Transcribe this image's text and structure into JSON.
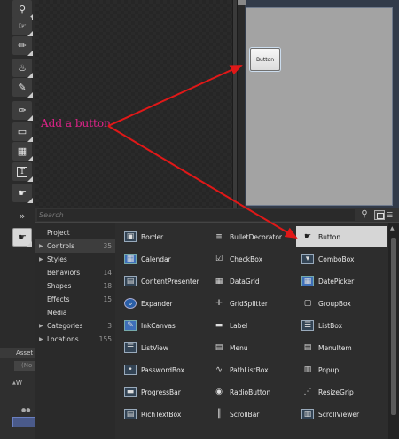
{
  "annotation": {
    "text": "Add a button"
  },
  "canvas": {
    "button_label": "Button"
  },
  "search": {
    "placeholder": "Search"
  },
  "icons": {
    "zoom": "magnifier-icon",
    "direct_select": "direct-select-icon",
    "eyedropper": "eyedropper-icon",
    "paint_bucket": "paint-bucket-icon",
    "pencil": "pencil-icon",
    "pen": "pen-icon",
    "rectangle": "rectangle-icon",
    "grid": "grid-icon",
    "text": "text-icon",
    "hand_select": "hand-select-icon"
  },
  "categories": [
    {
      "label": "Project",
      "count": "",
      "expandable": false,
      "selected": false
    },
    {
      "label": "Controls",
      "count": "35",
      "expandable": true,
      "selected": true
    },
    {
      "label": "Styles",
      "count": "",
      "expandable": true,
      "selected": false
    },
    {
      "label": "Behaviors",
      "count": "14",
      "expandable": false,
      "selected": false
    },
    {
      "label": "Shapes",
      "count": "18",
      "expandable": false,
      "selected": false
    },
    {
      "label": "Effects",
      "count": "15",
      "expandable": false,
      "selected": false
    },
    {
      "label": "Media",
      "count": "",
      "expandable": false,
      "selected": false
    },
    {
      "label": "Categories",
      "count": "3",
      "expandable": true,
      "selected": false
    },
    {
      "label": "Locations",
      "count": "155",
      "expandable": true,
      "selected": false
    }
  ],
  "controls": [
    {
      "label": "Border",
      "icon": "border-icon",
      "selected": false
    },
    {
      "label": "BulletDecorator",
      "icon": "bullet-decorator-icon",
      "selected": false
    },
    {
      "label": "Button",
      "icon": "button-icon",
      "selected": true
    },
    {
      "label": "Calendar",
      "icon": "calendar-icon",
      "selected": false
    },
    {
      "label": "CheckBox",
      "icon": "checkbox-icon",
      "selected": false
    },
    {
      "label": "ComboBox",
      "icon": "combobox-icon",
      "selected": false
    },
    {
      "label": "ContentPresenter",
      "icon": "content-presenter-icon",
      "selected": false
    },
    {
      "label": "DataGrid",
      "icon": "datagrid-icon",
      "selected": false
    },
    {
      "label": "DatePicker",
      "icon": "datepicker-icon",
      "selected": false
    },
    {
      "label": "Expander",
      "icon": "expander-icon",
      "selected": false
    },
    {
      "label": "GridSplitter",
      "icon": "grid-splitter-icon",
      "selected": false
    },
    {
      "label": "GroupBox",
      "icon": "groupbox-icon",
      "selected": false
    },
    {
      "label": "InkCanvas",
      "icon": "ink-canvas-icon",
      "selected": false
    },
    {
      "label": "Label",
      "icon": "label-icon",
      "selected": false
    },
    {
      "label": "ListBox",
      "icon": "listbox-icon",
      "selected": false
    },
    {
      "label": "ListView",
      "icon": "listview-icon",
      "selected": false
    },
    {
      "label": "Menu",
      "icon": "menu-icon",
      "selected": false
    },
    {
      "label": "MenuItem",
      "icon": "menuitem-icon",
      "selected": false
    },
    {
      "label": "PasswordBox",
      "icon": "passwordbox-icon",
      "selected": false
    },
    {
      "label": "PathListBox",
      "icon": "pathlistbox-icon",
      "selected": false
    },
    {
      "label": "Popup",
      "icon": "popup-icon",
      "selected": false
    },
    {
      "label": "ProgressBar",
      "icon": "progressbar-icon",
      "selected": false
    },
    {
      "label": "RadioButton",
      "icon": "radiobutton-icon",
      "selected": false
    },
    {
      "label": "ResizeGrip",
      "icon": "resizegrip-icon",
      "selected": false
    },
    {
      "label": "RichTextBox",
      "icon": "richtextbox-icon",
      "selected": false
    },
    {
      "label": "ScrollBar",
      "icon": "scrollbar-icon",
      "selected": false
    },
    {
      "label": "ScrollViewer",
      "icon": "scrollviewer-icon",
      "selected": false
    }
  ],
  "bottom_left": {
    "tab_label": "Asset",
    "field_label": "(No",
    "tree_label": "W"
  },
  "colors": {
    "annotation": "#e0238a",
    "arrow": "#e01818",
    "selection": "#d6d6d6"
  }
}
